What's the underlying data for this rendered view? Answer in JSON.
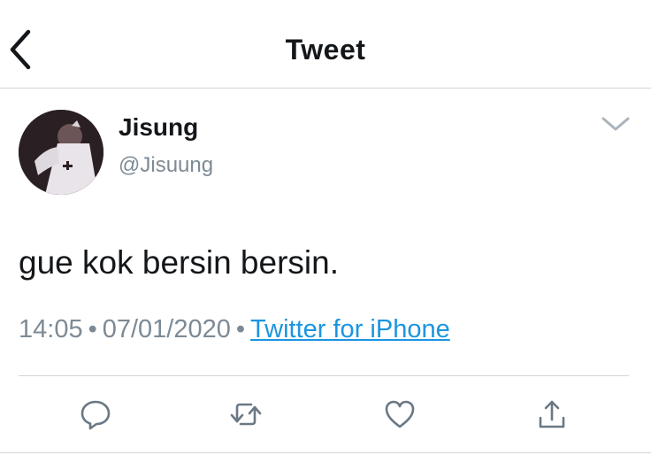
{
  "header": {
    "title": "Tweet",
    "back_icon": "chevron-left-icon"
  },
  "tweet": {
    "author_name": "Jisung",
    "author_handle": "@Jisuung",
    "text": "gue kok bersin bersin.",
    "time": "14:05",
    "date": "07/01/2020",
    "separator": "•",
    "source": "Twitter for iPhone",
    "menu_icon": "chevron-down-icon"
  },
  "actions": [
    {
      "icon": "reply-icon"
    },
    {
      "icon": "retweet-icon"
    },
    {
      "icon": "like-icon"
    },
    {
      "icon": "share-icon"
    }
  ],
  "colors": {
    "text": "#14171a",
    "secondary": "#7d8a95",
    "link": "#1b95e0",
    "divider": "#cfd5da"
  }
}
